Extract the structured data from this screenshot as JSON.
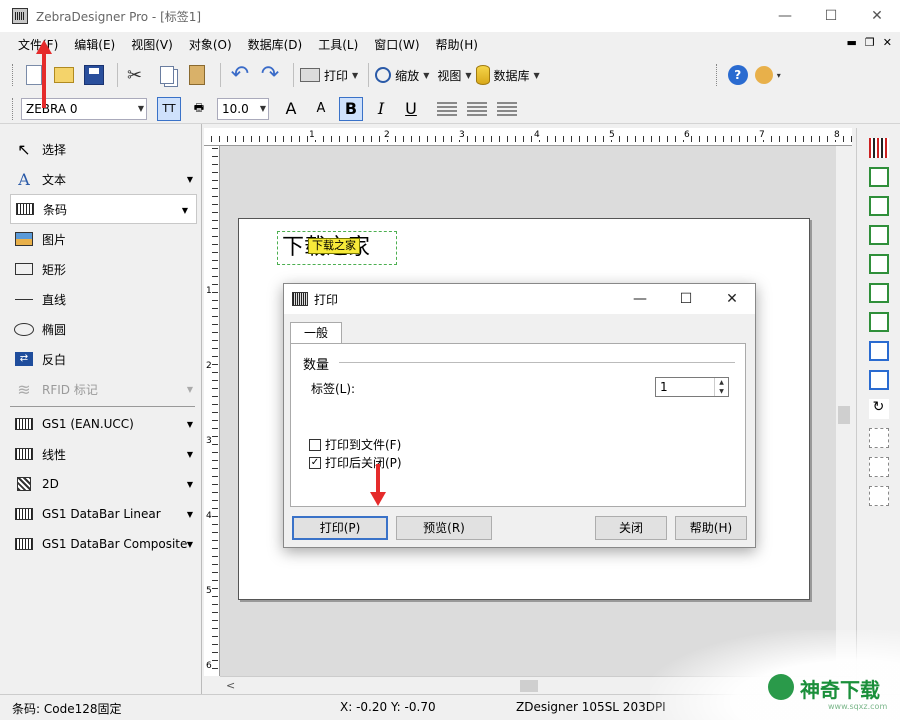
{
  "window": {
    "title": "ZebraDesigner Pro - [标签1]"
  },
  "menu": [
    {
      "label": "文件(F)"
    },
    {
      "label": "编辑(E)"
    },
    {
      "label": "视图(V)"
    },
    {
      "label": "对象(O)"
    },
    {
      "label": "数据库(D)"
    },
    {
      "label": "工具(L)"
    },
    {
      "label": "窗口(W)"
    },
    {
      "label": "帮助(H)"
    }
  ],
  "toolbar": {
    "print_label": "打印",
    "zoom_label": "缩放",
    "view_label": "视图",
    "database_label": "数据库"
  },
  "format_toolbar": {
    "printer": "ZEBRA 0",
    "font_size": "10.0",
    "bold": "B",
    "italic": "I",
    "underline": "U"
  },
  "toolbox": {
    "items": [
      {
        "label": "选择"
      },
      {
        "label": "文本"
      },
      {
        "label": "条码"
      },
      {
        "label": "图片"
      },
      {
        "label": "矩形"
      },
      {
        "label": "直线"
      },
      {
        "label": "椭圆"
      },
      {
        "label": "反白"
      },
      {
        "label": "RFID 标记"
      }
    ],
    "barcodes": [
      {
        "label": "GS1 (EAN.UCC)"
      },
      {
        "label": "线性"
      },
      {
        "label": "2D"
      },
      {
        "label": "GS1 DataBar Linear"
      },
      {
        "label": "GS1 DataBar Composite"
      }
    ]
  },
  "ruler": {
    "h_ticks": [
      "1",
      "2",
      "3",
      "4",
      "5",
      "6",
      "7",
      "8"
    ],
    "v_ticks": [
      "1",
      "2",
      "3",
      "4",
      "5",
      "6"
    ]
  },
  "label": {
    "text": "下载之家",
    "badge": "下载之家"
  },
  "dialog": {
    "title": "打印",
    "tab": "一般",
    "group": "数量",
    "labels_field": "标签(L):",
    "labels_value": "1",
    "print_to_file": "打印到文件(F)",
    "close_after_print": "打印后关闭(P)",
    "buttons": {
      "print": "打印(P)",
      "preview": "预览(R)",
      "close": "关闭",
      "help": "帮助(H)"
    }
  },
  "status": {
    "left": "条码: Code128固定",
    "coords": "X: -0.20 Y: -0.70",
    "printer": "ZDesigner 105SL 203DPI"
  },
  "logo": {
    "text": "神奇下载",
    "url": "www.sqxz.com"
  }
}
